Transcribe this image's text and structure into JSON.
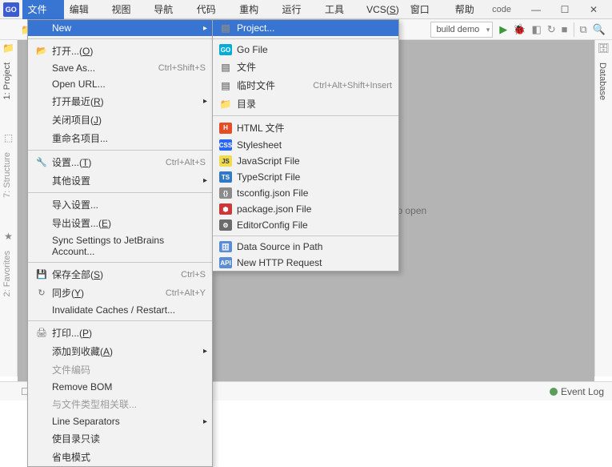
{
  "window": {
    "title": "code"
  },
  "menubar": {
    "logo": "GO",
    "items": [
      "文件(F)",
      "编辑(E)",
      "视图(V)",
      "导航(N)",
      "代码(C)",
      "重构(R)",
      "运行(U)",
      "工具(T)",
      "VCS(S)",
      "窗口(W)",
      "帮助(H)"
    ],
    "active_index": 0
  },
  "toolbar": {
    "breadcrumb_char": "c",
    "build_config": "build demo"
  },
  "file_menu": [
    {
      "label": "New",
      "icon": "",
      "highlighted": true,
      "arrow": true
    },
    "sep",
    {
      "label": "打开...(O)",
      "icon": "📂",
      "shortcut": "",
      "underline": "O"
    },
    {
      "label": "Save As...",
      "icon": "",
      "shortcut": "Ctrl+Shift+S"
    },
    {
      "label": "Open URL...",
      "icon": ""
    },
    {
      "label": "打开最近(R)",
      "icon": "",
      "arrow": true,
      "underline": "R"
    },
    {
      "label": "关闭项目(J)",
      "icon": "",
      "underline": "J"
    },
    {
      "label": "重命名项目...",
      "icon": ""
    },
    "sep",
    {
      "label": "设置...(T)",
      "icon": "🔧",
      "shortcut": "Ctrl+Alt+S",
      "underline": "T"
    },
    {
      "label": "其他设置",
      "icon": "",
      "arrow": true
    },
    "sep",
    {
      "label": "导入设置...",
      "icon": ""
    },
    {
      "label": "导出设置...(E)",
      "icon": "",
      "underline": "E"
    },
    {
      "label": "Sync Settings to JetBrains Account...",
      "icon": ""
    },
    "sep",
    {
      "label": "保存全部(S)",
      "icon": "💾",
      "shortcut": "Ctrl+S",
      "underline": "S"
    },
    {
      "label": "同步(Y)",
      "icon": "↻",
      "shortcut": "Ctrl+Alt+Y",
      "underline": "Y"
    },
    {
      "label": "Invalidate Caches / Restart...",
      "icon": ""
    },
    "sep",
    {
      "label": "打印...(P)",
      "icon": "🖨",
      "underline": "P"
    },
    {
      "label": "添加到收藏(A)",
      "icon": "",
      "arrow": true,
      "underline": "A"
    },
    {
      "label": "文件编码",
      "icon": "",
      "disabled": true
    },
    {
      "label": "Remove BOM",
      "icon": ""
    },
    {
      "label": "与文件类型相关联...",
      "icon": "",
      "disabled": true
    },
    {
      "label": "Line Separators",
      "icon": "",
      "arrow": true
    },
    {
      "label": "使目录只读",
      "icon": ""
    },
    {
      "label": "省电模式",
      "icon": ""
    }
  ],
  "new_submenu": [
    {
      "label": "Project...",
      "highlighted": true,
      "iconClass": "ic-paper",
      "glyph": "▤"
    },
    "sep",
    {
      "label": "Go File",
      "iconClass": "ic-go",
      "glyph": "GO"
    },
    {
      "label": "文件",
      "iconClass": "ic-paper",
      "glyph": "▤"
    },
    {
      "label": "临时文件",
      "iconClass": "ic-paper",
      "glyph": "▤",
      "shortcut": "Ctrl+Alt+Shift+Insert"
    },
    {
      "label": "目录",
      "iconClass": "ic-folder",
      "glyph": "📁"
    },
    "sep",
    {
      "label": "HTML 文件",
      "iconClass": "ic-html",
      "glyph": "H"
    },
    {
      "label": "Stylesheet",
      "iconClass": "ic-css",
      "glyph": "CSS"
    },
    {
      "label": "JavaScript File",
      "iconClass": "ic-js",
      "glyph": "JS"
    },
    {
      "label": "TypeScript File",
      "iconClass": "ic-ts",
      "glyph": "TS"
    },
    {
      "label": "tsconfig.json File",
      "iconClass": "ic-json",
      "glyph": "{}"
    },
    {
      "label": "package.json File",
      "iconClass": "ic-pkg",
      "glyph": "⬢"
    },
    {
      "label": "EditorConfig File",
      "iconClass": "ic-edit",
      "glyph": "⚙"
    },
    "sep",
    {
      "label": "Data Source in Path",
      "iconClass": "ic-db",
      "glyph": "🗄"
    },
    {
      "label": "New HTTP Request",
      "iconClass": "ic-api",
      "glyph": "API"
    }
  ],
  "sidebar_left": [
    {
      "label": "1: Project",
      "icon": "📁"
    },
    {
      "label": "7: Structure",
      "icon": "⬚",
      "dim": true
    },
    {
      "label": "2: Favorites",
      "icon": "★",
      "dim": true
    }
  ],
  "sidebar_right": [
    {
      "label": "Database",
      "icon": "🗄"
    }
  ],
  "main": {
    "drop_text": "Drop files here to open"
  },
  "statusbar": {
    "event_log": "Event Log",
    "tool_c": "C"
  }
}
